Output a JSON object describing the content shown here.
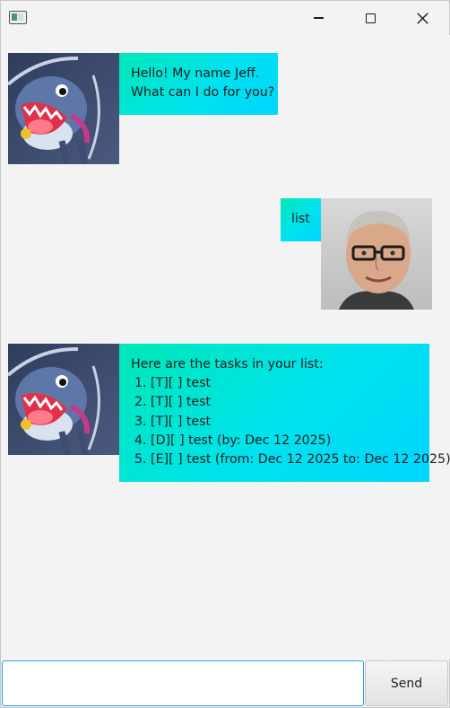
{
  "window": {
    "title_icon": "app-window-icon",
    "controls": [
      "minimize-icon",
      "maximize-icon",
      "close-icon"
    ]
  },
  "messages": [
    {
      "sender": "bot",
      "avatar": "shark-avatar",
      "lines": [
        "Hello! My name Jeff.",
        "What can I do for you?"
      ]
    },
    {
      "sender": "user",
      "avatar": "user-photo-avatar",
      "text": "list"
    },
    {
      "sender": "bot",
      "avatar": "shark-avatar",
      "header": "Here are the tasks in your list:",
      "tasks": [
        "1. [T][ ] test",
        "2. [T][ ] test",
        "3. [T][ ] test",
        "4. [D][ ] test (by: Dec 12 2025)",
        "5. [E][ ] test (from: Dec 12 2025 to: Dec 12 2025)"
      ]
    }
  ],
  "input": {
    "value": "",
    "placeholder": "",
    "send_label": "Send"
  },
  "colors": {
    "bubble_gradient_start": "#00e8b8",
    "bubble_gradient_end": "#00d6ff",
    "input_focus_border": "#29a5d6",
    "background": "#f3f3f3"
  }
}
